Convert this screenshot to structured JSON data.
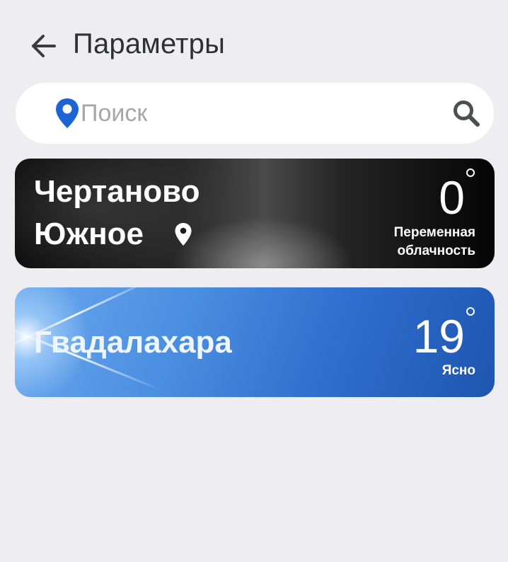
{
  "header": {
    "title": "Параметры",
    "back_icon": "arrow-left-icon"
  },
  "search": {
    "placeholder": "Поиск",
    "value": "",
    "location_icon": "location-pin-icon",
    "search_icon": "search-icon",
    "accent_color": "#1a64d6"
  },
  "cities": [
    {
      "name_line1": "Чертаново",
      "name_line2": "Южное",
      "temperature": "0",
      "condition_line1": "Переменная",
      "condition_line2": "облачность",
      "is_current_location": true,
      "location_icon": "location-pin-icon"
    },
    {
      "name": "Гвадалахара",
      "temperature": "19",
      "condition": "Ясно",
      "is_current_location": false
    }
  ]
}
